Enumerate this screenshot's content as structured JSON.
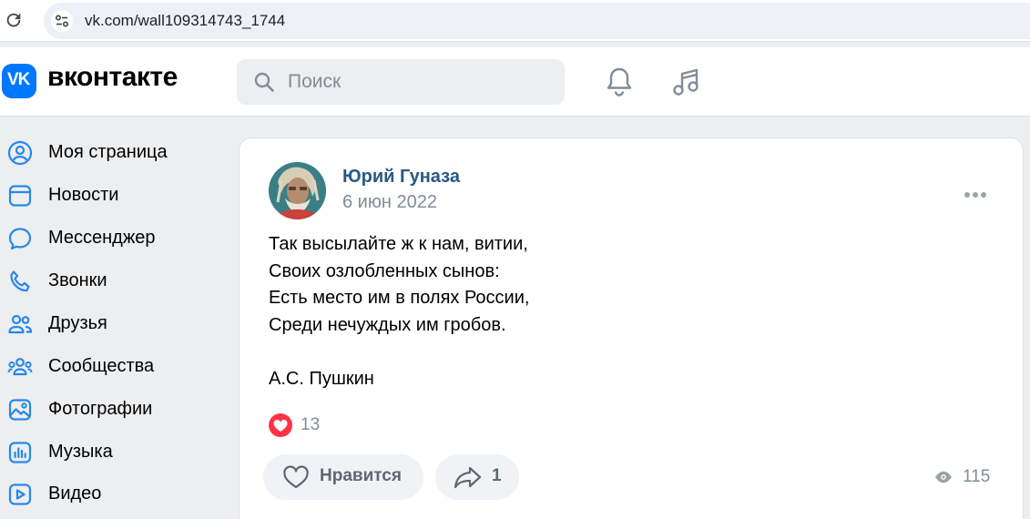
{
  "browser": {
    "url": "vk.com/wall109314743_1744"
  },
  "header": {
    "logo_glyph": "VK",
    "wordmark": "вконтакте",
    "search_placeholder": "Поиск",
    "icons": [
      "bell-icon",
      "music-icon"
    ],
    "brand_color": "#0077ff"
  },
  "sidebar": {
    "items": [
      {
        "label": "Моя страница",
        "icon": "user-circle-icon"
      },
      {
        "label": "Новости",
        "icon": "news-icon"
      },
      {
        "label": "Мессенджер",
        "icon": "message-icon"
      },
      {
        "label": "Звонки",
        "icon": "phone-icon"
      },
      {
        "label": "Друзья",
        "icon": "friends-icon"
      },
      {
        "label": "Сообщества",
        "icon": "communities-icon"
      },
      {
        "label": "Фотографии",
        "icon": "photo-icon"
      },
      {
        "label": "Музыка",
        "icon": "music-bars-icon"
      },
      {
        "label": "Видео",
        "icon": "video-icon"
      }
    ],
    "icon_color": "#2688eb"
  },
  "post": {
    "author": "Юрий Гуназа",
    "date": "6 июн 2022",
    "text_lines": [
      "Так высылайте ж к нам, витии,",
      "Своих озлобленных сынов:",
      "Есть место им в полях России,",
      "Среди нечуждых им гробов.",
      "",
      "А.С. Пушкин"
    ],
    "reaction_count": "13",
    "like_label": "Нравится",
    "share_count": "1",
    "views_count": "115",
    "author_color": "#2a5885",
    "reaction_color": "#ff3347"
  }
}
